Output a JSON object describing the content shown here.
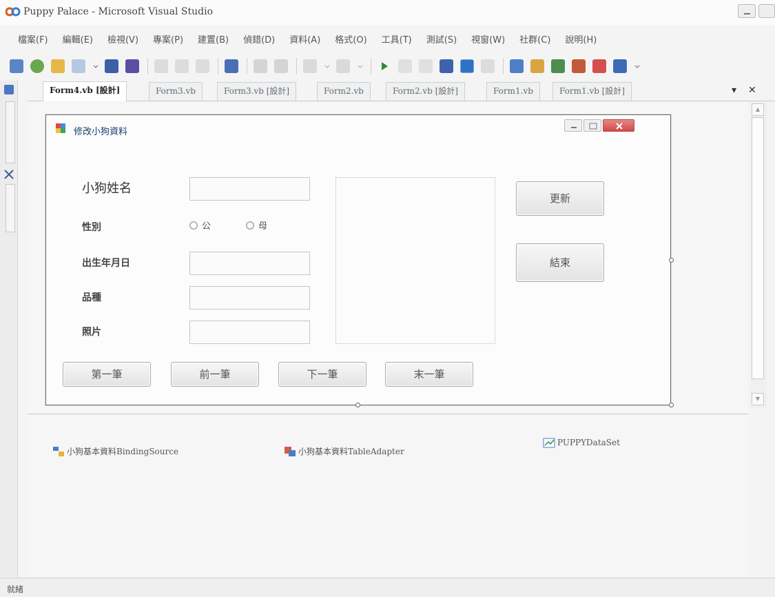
{
  "app": {
    "title": "Puppy Palace - Microsoft Visual Studio"
  },
  "menu": [
    "檔案(F)",
    "編輯(E)",
    "檢視(V)",
    "專案(P)",
    "建置(B)",
    "偵錯(D)",
    "資料(A)",
    "格式(O)",
    "工具(T)",
    "測試(S)",
    "視窗(W)",
    "社群(C)",
    "說明(H)"
  ],
  "tabs": [
    "Form4.vb [設計]",
    "Form3.vb",
    "Form3.vb [設計]",
    "Form2.vb",
    "Form2.vb [設計]",
    "Form1.vb",
    "Form1.vb [設計]"
  ],
  "tab_controls": {
    "dropdown": "▾",
    "close": "✕"
  },
  "form": {
    "title": "修改小狗資料",
    "labels": {
      "name": "小狗姓名",
      "gender": "性別",
      "birthday": "出生年月日",
      "breed": "品種",
      "photo": "照片"
    },
    "gender_options": [
      "公",
      "母"
    ],
    "buttons": {
      "update": "更新",
      "exit": "結束",
      "first": "第一筆",
      "prev": "前一筆",
      "next": "下一筆",
      "last": "末一筆"
    }
  },
  "components": [
    "小狗基本資料BindingSource",
    "小狗基本資料TableAdapter",
    "PUPPYDataSet"
  ],
  "status": {
    "text": "就緒"
  },
  "colors": {
    "accent": "#1b3c6e",
    "close_button": "#d04a4a"
  }
}
